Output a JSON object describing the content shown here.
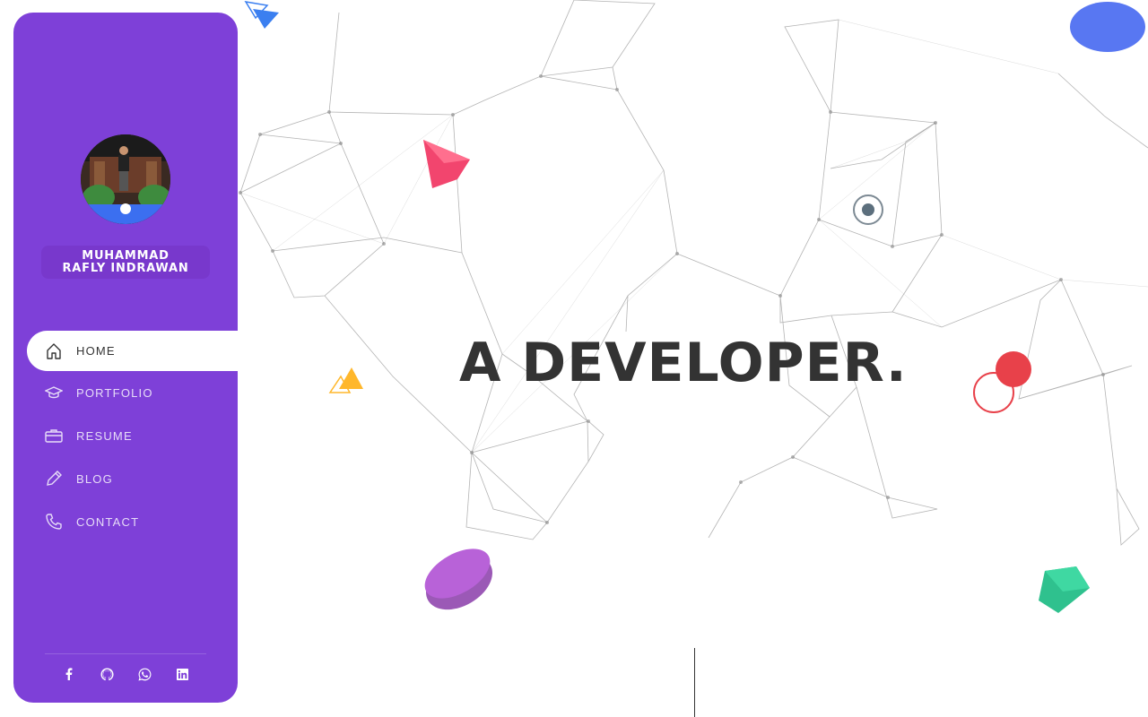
{
  "profile": {
    "name": "MUHAMMAD\nRAFLY INDRAWAN",
    "avatar_alt": "profile photo"
  },
  "nav": {
    "items": [
      {
        "label": "HOME",
        "icon": "home-icon",
        "active": true
      },
      {
        "label": "PORTFOLIO",
        "icon": "graduation-cap-icon",
        "active": false
      },
      {
        "label": "RESUME",
        "icon": "briefcase-icon",
        "active": false
      },
      {
        "label": "BLOG",
        "icon": "pencil-icon",
        "active": false
      },
      {
        "label": "CONTACT",
        "icon": "phone-icon",
        "active": false
      }
    ]
  },
  "socials": [
    {
      "icon": "facebook-icon"
    },
    {
      "icon": "github-icon"
    },
    {
      "icon": "whatsapp-icon"
    },
    {
      "icon": "linkedin-icon"
    }
  ],
  "hero": {
    "title": "A DEVELOPER."
  },
  "colors": {
    "sidebar": "#7e40d8",
    "title": "#333333",
    "accent_red": "#e8414a",
    "accent_pink": "#f2456e",
    "accent_yellow": "#ffb72b",
    "accent_green": "#2fc18e",
    "accent_blue": "#3b6ff0"
  }
}
